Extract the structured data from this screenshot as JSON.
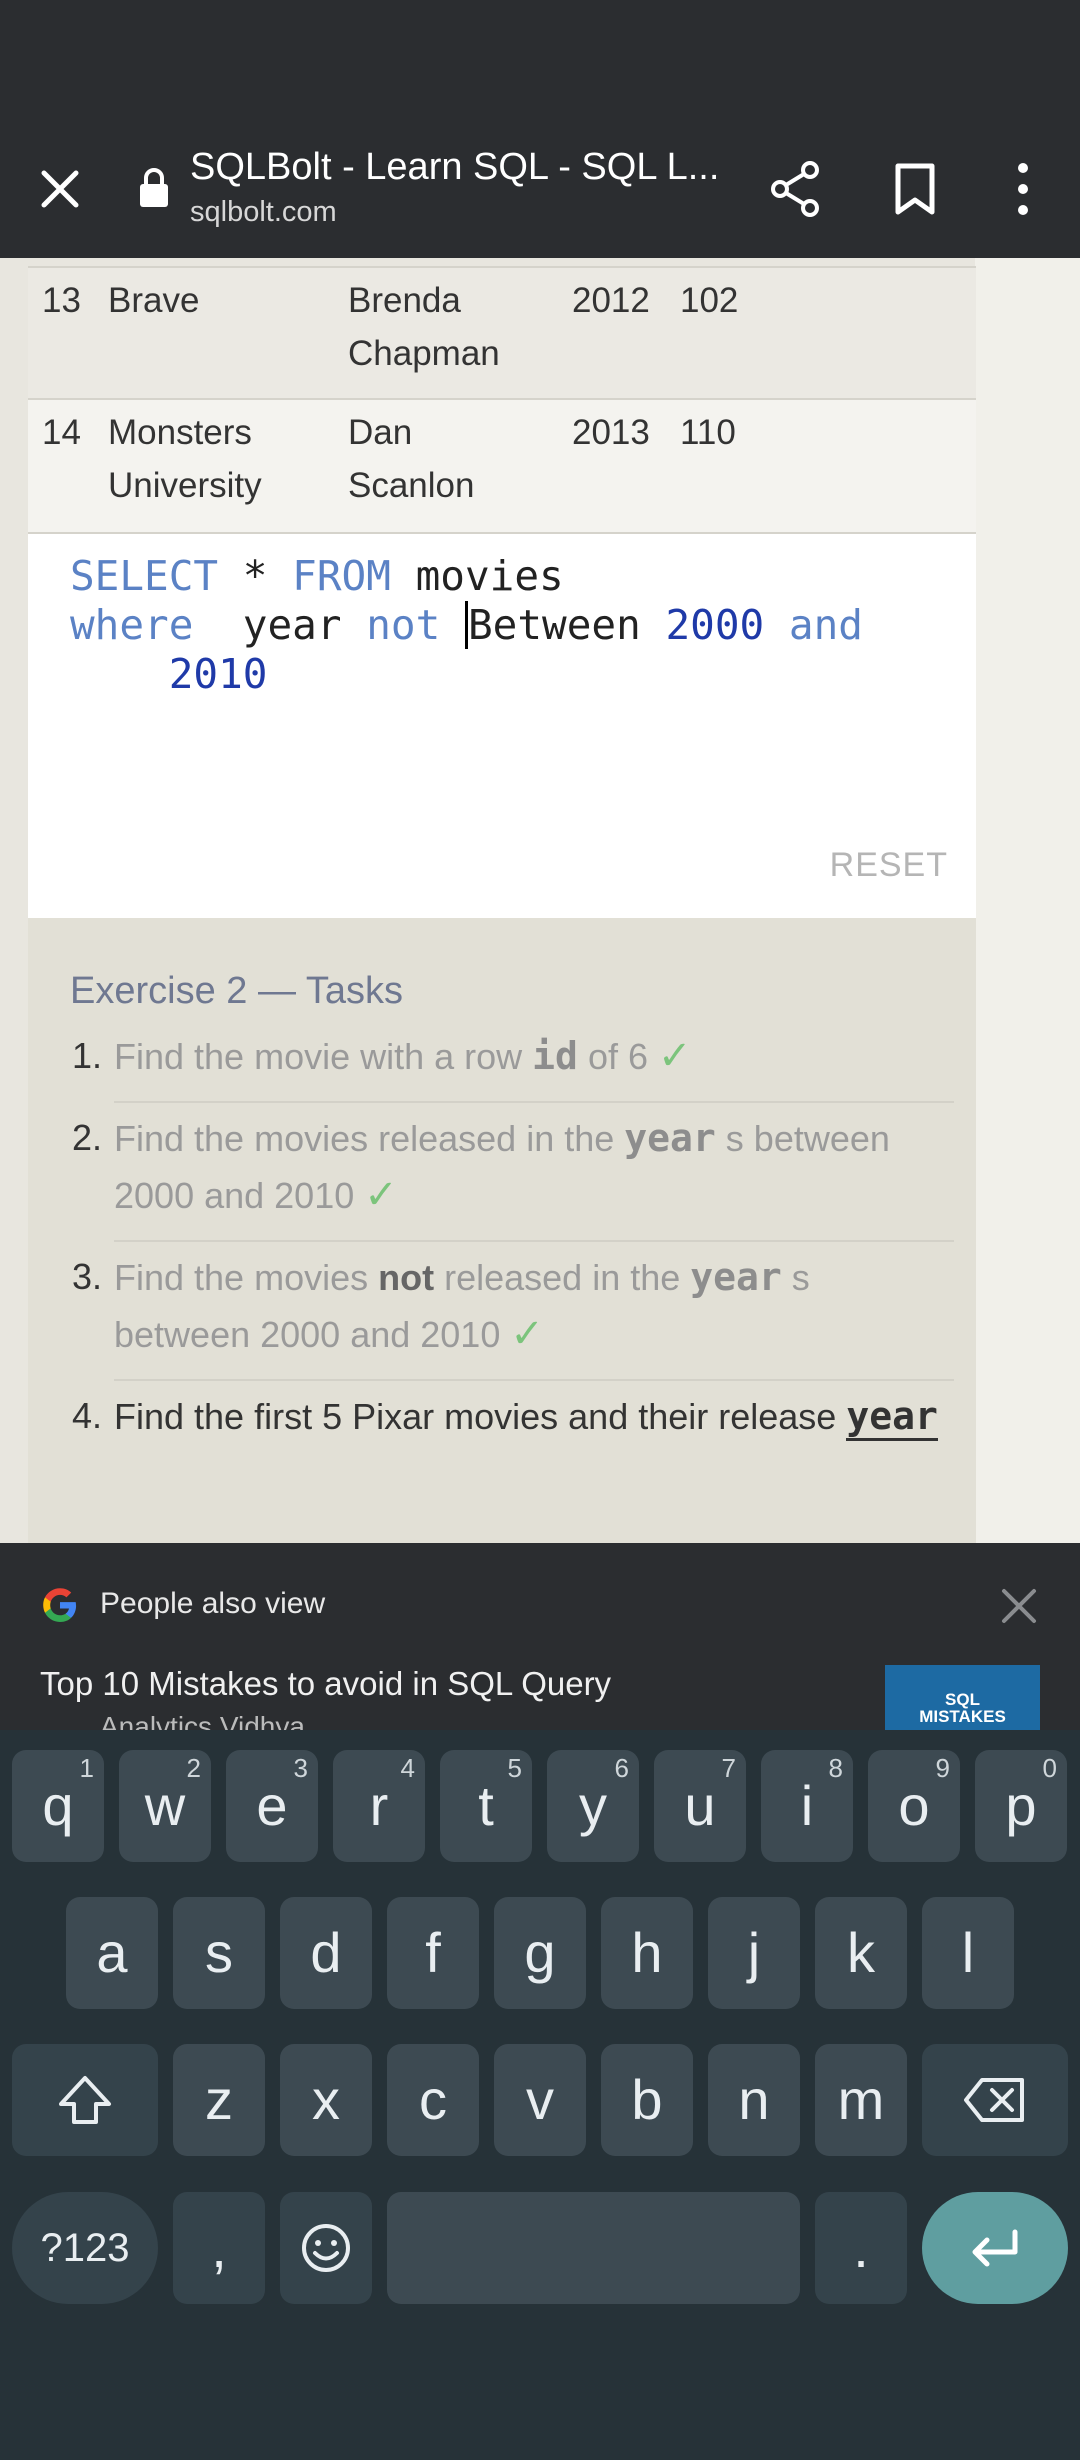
{
  "browser": {
    "title": "SQLBolt - Learn SQL - SQL L...",
    "domain": "sqlbolt.com"
  },
  "table_rows": [
    {
      "id": "13",
      "title": "Brave",
      "director_line1": "Brenda",
      "director_line2": "Chapman",
      "year": "2012",
      "length": "102"
    },
    {
      "id": "14",
      "title_line1": "Monsters",
      "title_line2": "University",
      "director_line1": "Dan",
      "director_line2": "Scanlon",
      "year": "2013",
      "length": "110"
    }
  ],
  "editor": {
    "line1_kw1": "SELECT",
    "line1_star": "*",
    "line1_kw2": "FROM",
    "line1_table": "movies",
    "line2_kw1": "where",
    "line2_col": "year",
    "line2_kw2": "not",
    "line2_between": "Between",
    "line2_num1": "2000",
    "line2_and": "and",
    "line3_num2": "2010",
    "reset_label": "RESET"
  },
  "exercise": {
    "title": "Exercise 2 — Tasks",
    "tasks": [
      {
        "n": "1.",
        "pre": "Find the movie with a row ",
        "code": "id",
        "post": " of 6"
      },
      {
        "n": "2.",
        "pre": "Find the movies released in the ",
        "code": "year",
        "post": " s between 2000 and 2010"
      },
      {
        "n": "3.",
        "pre1": "Find the movies ",
        "bold": "not",
        "pre2": " released in the ",
        "code": "year",
        "post": " s between 2000 and 2010"
      },
      {
        "n": "4.",
        "pre": "Find the first 5 Pixar movies and their release ",
        "code": "year"
      }
    ],
    "check": "✓"
  },
  "people_also_view": {
    "label": "People also view",
    "article_title": "Top 10 Mistakes to avoid in SQL Query",
    "article_source": "Analytics Vidhya",
    "thumb_text_1": "SQL",
    "thumb_text_2": "MISTAKES"
  },
  "keyboard": {
    "row1": [
      [
        "q",
        "1"
      ],
      [
        "w",
        "2"
      ],
      [
        "e",
        "3"
      ],
      [
        "r",
        "4"
      ],
      [
        "t",
        "5"
      ],
      [
        "y",
        "6"
      ],
      [
        "u",
        "7"
      ],
      [
        "i",
        "8"
      ],
      [
        "o",
        "9"
      ],
      [
        "p",
        "0"
      ]
    ],
    "row2": [
      "a",
      "s",
      "d",
      "f",
      "g",
      "h",
      "j",
      "k",
      "l"
    ],
    "row3": [
      "z",
      "x",
      "c",
      "v",
      "b",
      "n",
      "m"
    ],
    "symbols_label": "?123",
    "comma": ",",
    "period": "."
  }
}
